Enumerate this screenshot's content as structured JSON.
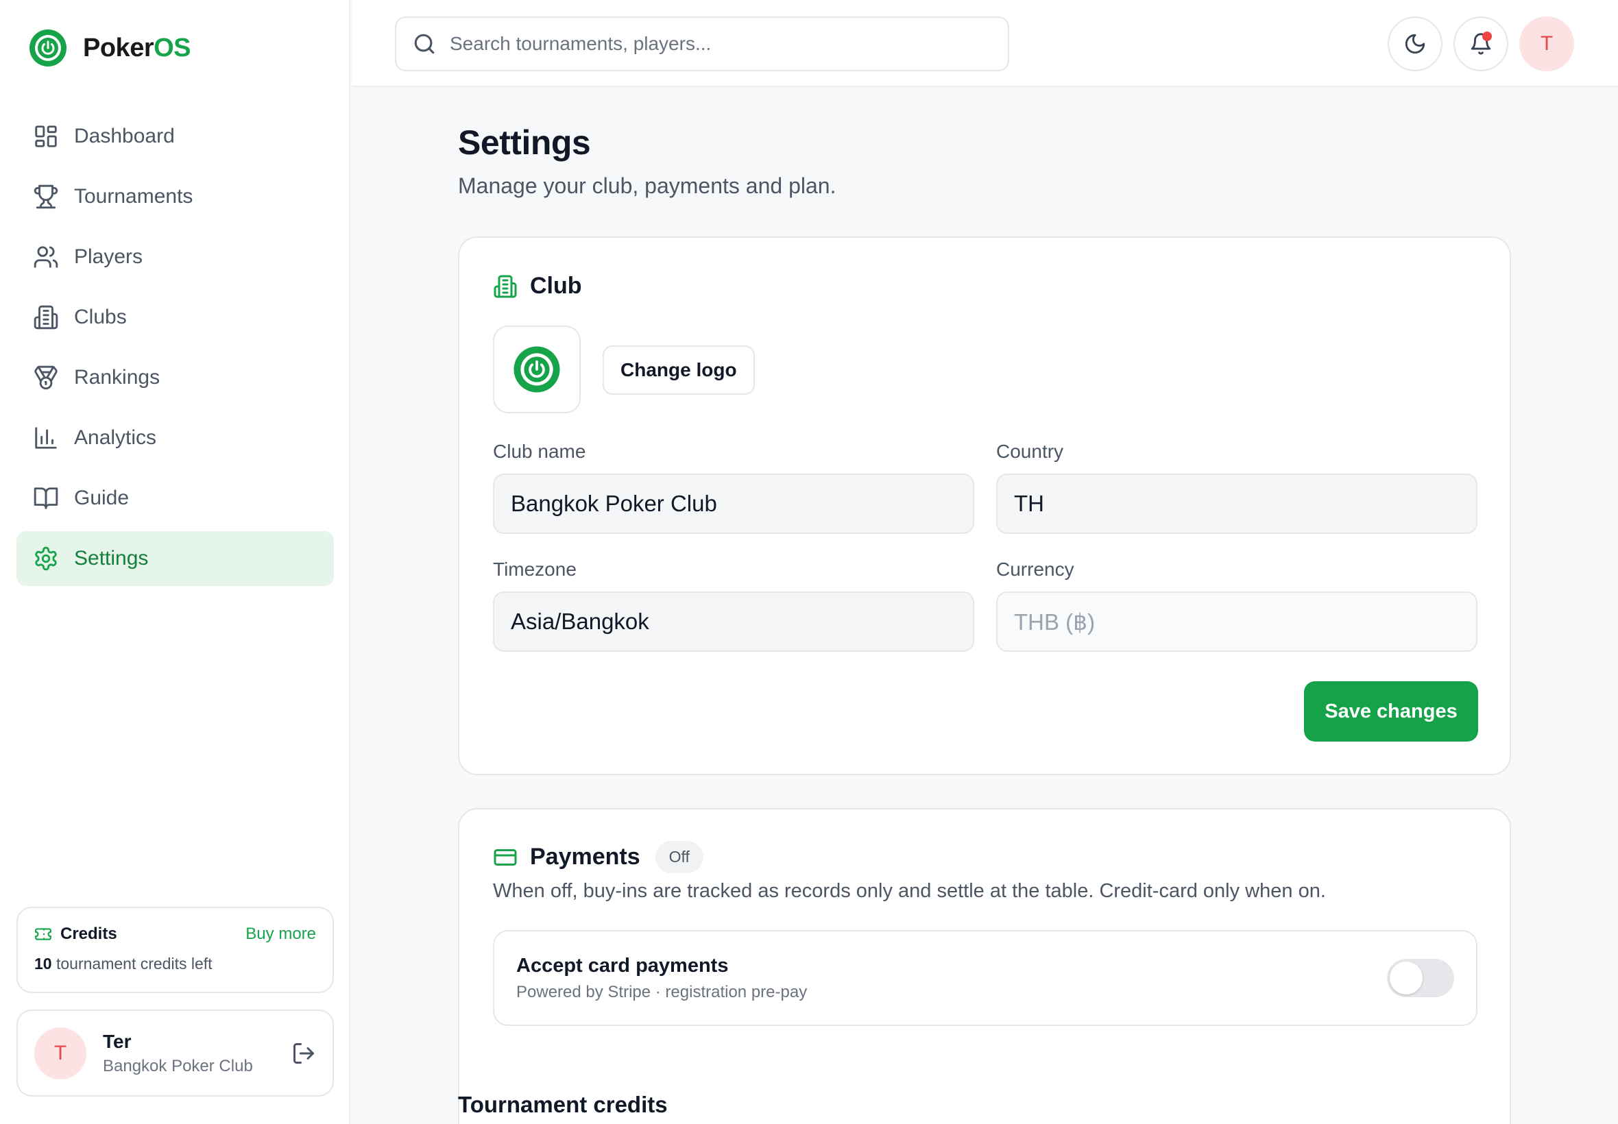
{
  "brand": {
    "name_prefix": "Poker",
    "name_accent": "OS"
  },
  "nav": [
    {
      "label": "Dashboard",
      "icon": "dashboard-icon",
      "active": false
    },
    {
      "label": "Tournaments",
      "icon": "trophy-icon",
      "active": false
    },
    {
      "label": "Players",
      "icon": "users-icon",
      "active": false
    },
    {
      "label": "Clubs",
      "icon": "building-icon",
      "active": false
    },
    {
      "label": "Rankings",
      "icon": "medal-icon",
      "active": false
    },
    {
      "label": "Analytics",
      "icon": "bar-chart-icon",
      "active": false
    },
    {
      "label": "Guide",
      "icon": "book-icon",
      "active": false
    },
    {
      "label": "Settings",
      "icon": "gear-icon",
      "active": true
    }
  ],
  "credits": {
    "title": "Credits",
    "buy_more": "Buy more",
    "count": "10",
    "suffix": "tournament credits left"
  },
  "user": {
    "initial": "T",
    "name": "Ter",
    "club": "Bangkok Poker Club"
  },
  "search": {
    "placeholder": "Search tournaments, players..."
  },
  "header": {
    "avatar_initial": "T"
  },
  "page": {
    "title": "Settings",
    "subtitle": "Manage your club, payments and plan."
  },
  "club": {
    "title": "Club",
    "change_logo": "Change logo",
    "name_label": "Club name",
    "name_value": "Bangkok Poker Club",
    "country_label": "Country",
    "country_value": "TH",
    "timezone_label": "Timezone",
    "timezone_value": "Asia/Bangkok",
    "currency_label": "Currency",
    "currency_value": "THB (฿)",
    "save": "Save changes"
  },
  "payments": {
    "title": "Payments",
    "badge": "Off",
    "description": "When off, buy-ins are tracked as records only and settle at the table. Credit-card only when on.",
    "accept_title": "Accept card payments",
    "accept_sub": "Powered by Stripe · registration pre-pay",
    "enabled": false
  },
  "tournament_credits": {
    "title": "Tournament credits"
  },
  "colors": {
    "accent": "#16a34a",
    "accent_bg": "#e6f5ea",
    "notification": "#ef4444",
    "avatar_bg": "#fde2e4"
  }
}
